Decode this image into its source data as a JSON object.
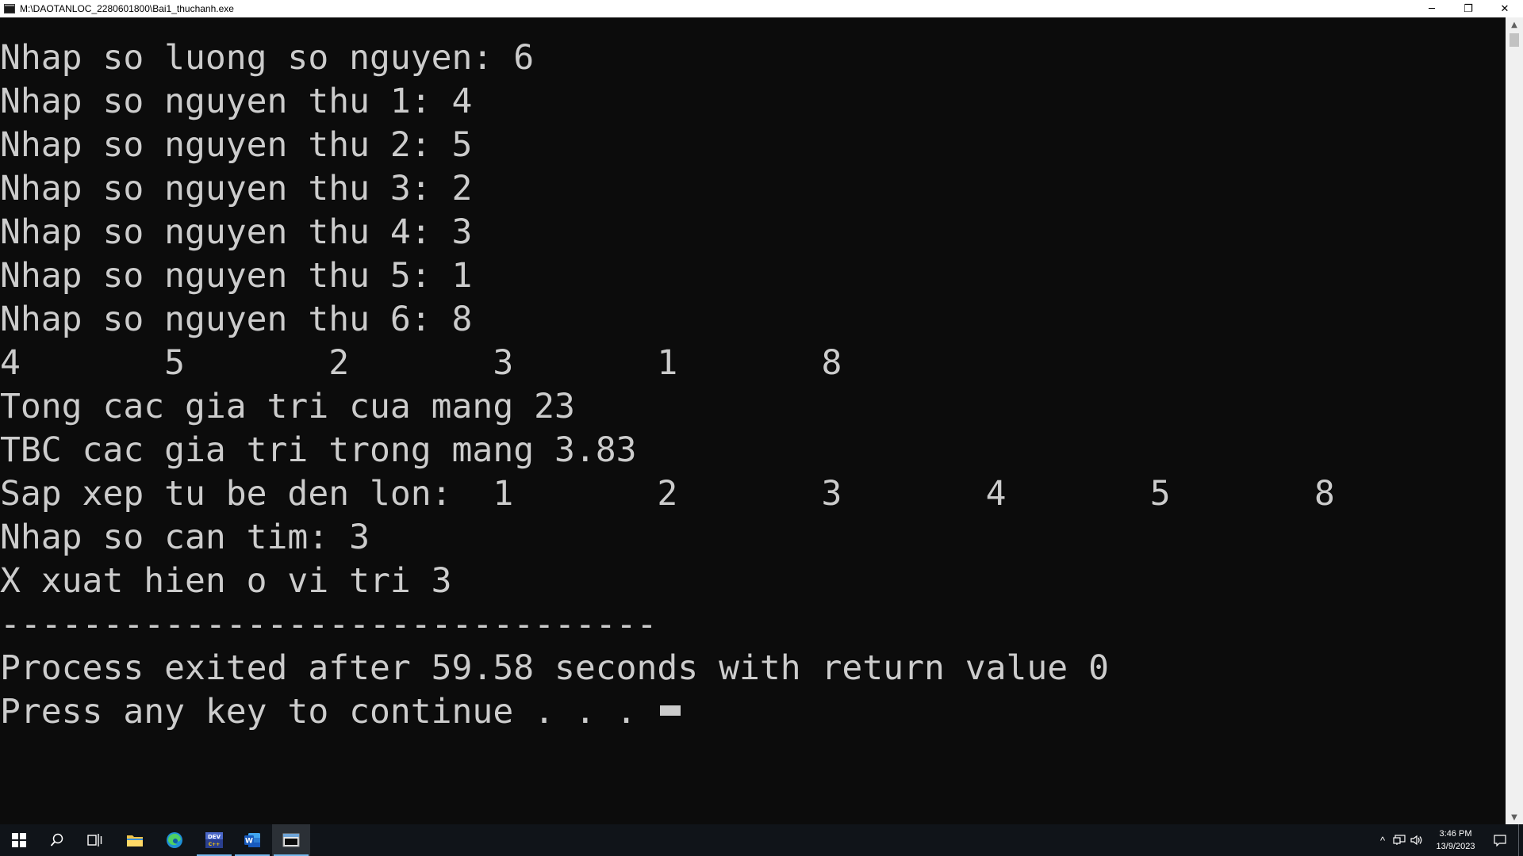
{
  "window": {
    "title": "M:\\DAOTANLOC_2280601800\\Bai1_thuchanh.exe",
    "minimize_symbol": "─",
    "restore_symbol": "❐",
    "close_symbol": "✕"
  },
  "console": {
    "lines": [
      "Nhap so luong so nguyen: 6",
      "Nhap so nguyen thu 1: 4",
      "Nhap so nguyen thu 2: 5",
      "Nhap so nguyen thu 3: 2",
      "Nhap so nguyen thu 4: 3",
      "Nhap so nguyen thu 5: 1",
      "Nhap so nguyen thu 6: 8",
      "4       5       2       3       1       8",
      "Tong cac gia tri cua mang 23",
      "TBC cac gia tri trong mang 3.83",
      "Sap xep tu be den lon:  1       2       3       4       5       8",
      "Nhap so can tim: 3",
      "X xuat hien o vi tri 3",
      "--------------------------------",
      "Process exited after 59.58 seconds with return value 0",
      "Press any key to continue . . . "
    ]
  },
  "colors": {
    "console_bg": "#0c0c0c",
    "console_text": "#cccccc",
    "taskbar_bg": "#101419",
    "active_indicator": "#76b9ed"
  },
  "taskbar": {
    "items": [
      {
        "name": "start",
        "icon": "windows-logo-icon"
      },
      {
        "name": "search",
        "icon": "search-icon"
      },
      {
        "name": "task-view",
        "icon": "task-view-icon"
      },
      {
        "name": "file-explorer",
        "icon": "folder-icon"
      },
      {
        "name": "edge",
        "icon": "edge-icon"
      },
      {
        "name": "dev-cpp",
        "icon": "dev-cpp-icon",
        "label": "DEV C++"
      },
      {
        "name": "word",
        "icon": "word-icon",
        "label": "W"
      },
      {
        "name": "console-app",
        "icon": "console-window-icon"
      }
    ],
    "tray": {
      "chevron": "^",
      "time": "3:46 PM",
      "date": "13/9/2023"
    }
  }
}
